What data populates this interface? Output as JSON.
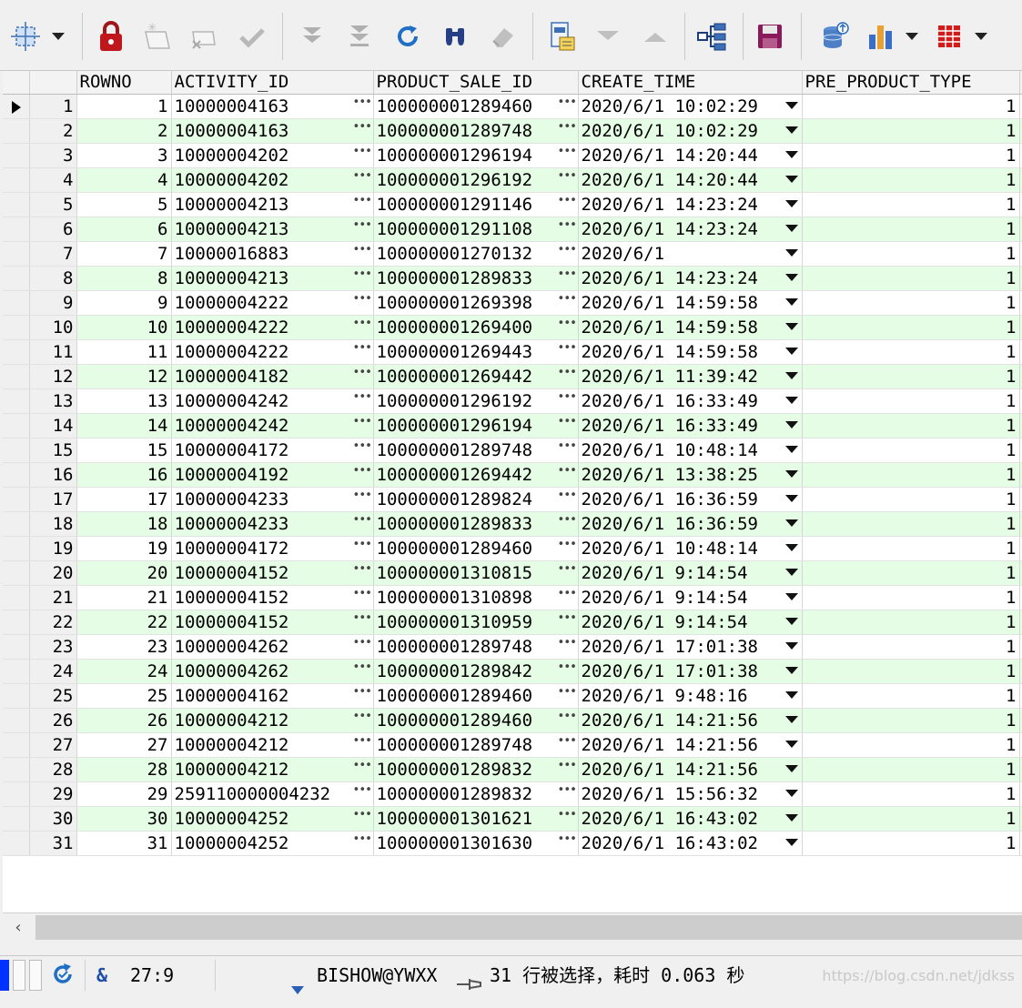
{
  "toolbar": {
    "icons": [
      "select-all-icon",
      "lock-icon",
      "new-record-icon",
      "delete-record-icon",
      "post-check-icon",
      "next-page-icon",
      "last-page-icon",
      "refresh-icon",
      "find-icon",
      "clear-icon",
      "query-by-example-icon",
      "next-record-icon",
      "previous-record-icon",
      "tree-view-icon",
      "save-icon",
      "export-db-icon",
      "chart-icon",
      "grid-view-icon"
    ],
    "colors": {
      "lock": "#c0171d",
      "save": "#8b1a5a",
      "refresh": "#1f6fc4",
      "find": "#243f86",
      "chart_orange": "#e8a033",
      "chart_blue": "#3a6ec8",
      "grid_red": "#d21c1c"
    }
  },
  "grid": {
    "columns": [
      "ROWNO",
      "ACTIVITY_ID",
      "PRODUCT_SALE_ID",
      "CREATE_TIME",
      "PRE_PRODUCT_TYPE"
    ],
    "alt_row_color": "#e4fde4",
    "rows": [
      [
        "1",
        "1",
        "10000004163",
        "100000001289460",
        "2020/6/1 10:02:29",
        "1"
      ],
      [
        "2",
        "2",
        "10000004163",
        "100000001289748",
        "2020/6/1 10:02:29",
        "1"
      ],
      [
        "3",
        "3",
        "10000004202",
        "100000001296194",
        "2020/6/1 14:20:44",
        "1"
      ],
      [
        "4",
        "4",
        "10000004202",
        "100000001296192",
        "2020/6/1 14:20:44",
        "1"
      ],
      [
        "5",
        "5",
        "10000004213",
        "100000001291146",
        "2020/6/1 14:23:24",
        "1"
      ],
      [
        "6",
        "6",
        "10000004213",
        "100000001291108",
        "2020/6/1 14:23:24",
        "1"
      ],
      [
        "7",
        "7",
        "10000016883",
        "100000001270132",
        "2020/6/1",
        "1"
      ],
      [
        "8",
        "8",
        "10000004213",
        "100000001289833",
        "2020/6/1 14:23:24",
        "1"
      ],
      [
        "9",
        "9",
        "10000004222",
        "100000001269398",
        "2020/6/1 14:59:58",
        "1"
      ],
      [
        "10",
        "10",
        "10000004222",
        "100000001269400",
        "2020/6/1 14:59:58",
        "1"
      ],
      [
        "11",
        "11",
        "10000004222",
        "100000001269443",
        "2020/6/1 14:59:58",
        "1"
      ],
      [
        "12",
        "12",
        "10000004182",
        "100000001269442",
        "2020/6/1 11:39:42",
        "1"
      ],
      [
        "13",
        "13",
        "10000004242",
        "100000001296192",
        "2020/6/1 16:33:49",
        "1"
      ],
      [
        "14",
        "14",
        "10000004242",
        "100000001296194",
        "2020/6/1 16:33:49",
        "1"
      ],
      [
        "15",
        "15",
        "10000004172",
        "100000001289748",
        "2020/6/1 10:48:14",
        "1"
      ],
      [
        "16",
        "16",
        "10000004192",
        "100000001269442",
        "2020/6/1 13:38:25",
        "1"
      ],
      [
        "17",
        "17",
        "10000004233",
        "100000001289824",
        "2020/6/1 16:36:59",
        "1"
      ],
      [
        "18",
        "18",
        "10000004233",
        "100000001289833",
        "2020/6/1 16:36:59",
        "1"
      ],
      [
        "19",
        "19",
        "10000004172",
        "100000001289460",
        "2020/6/1 10:48:14",
        "1"
      ],
      [
        "20",
        "20",
        "10000004152",
        "100000001310815",
        "2020/6/1 9:14:54",
        "1"
      ],
      [
        "21",
        "21",
        "10000004152",
        "100000001310898",
        "2020/6/1 9:14:54",
        "1"
      ],
      [
        "22",
        "22",
        "10000004152",
        "100000001310959",
        "2020/6/1 9:14:54",
        "1"
      ],
      [
        "23",
        "23",
        "10000004262",
        "100000001289748",
        "2020/6/1 17:01:38",
        "1"
      ],
      [
        "24",
        "24",
        "10000004262",
        "100000001289842",
        "2020/6/1 17:01:38",
        "1"
      ],
      [
        "25",
        "25",
        "10000004162",
        "100000001289460",
        "2020/6/1 9:48:16",
        "1"
      ],
      [
        "26",
        "26",
        "10000004212",
        "100000001289460",
        "2020/6/1 14:21:56",
        "1"
      ],
      [
        "27",
        "27",
        "10000004212",
        "100000001289748",
        "2020/6/1 14:21:56",
        "1"
      ],
      [
        "28",
        "28",
        "10000004212",
        "100000001289832",
        "2020/6/1 14:21:56",
        "1"
      ],
      [
        "29",
        "29",
        "259110000004232",
        "100000001289832",
        "2020/6/1 15:56:32",
        "1"
      ],
      [
        "30",
        "30",
        "10000004252",
        "100000001301621",
        "2020/6/1 16:43:02",
        "1"
      ],
      [
        "31",
        "31",
        "10000004252",
        "100000001301630",
        "2020/6/1 16:43:02",
        "1"
      ]
    ]
  },
  "status": {
    "position": "27:9",
    "connection": "BISHOW@YWXX",
    "message": "31 行被选择，耗时 0.063 秒",
    "watermark": "https://blog.csdn.net/jdkss",
    "ampersand": "&",
    "accent": "#0033ff"
  }
}
